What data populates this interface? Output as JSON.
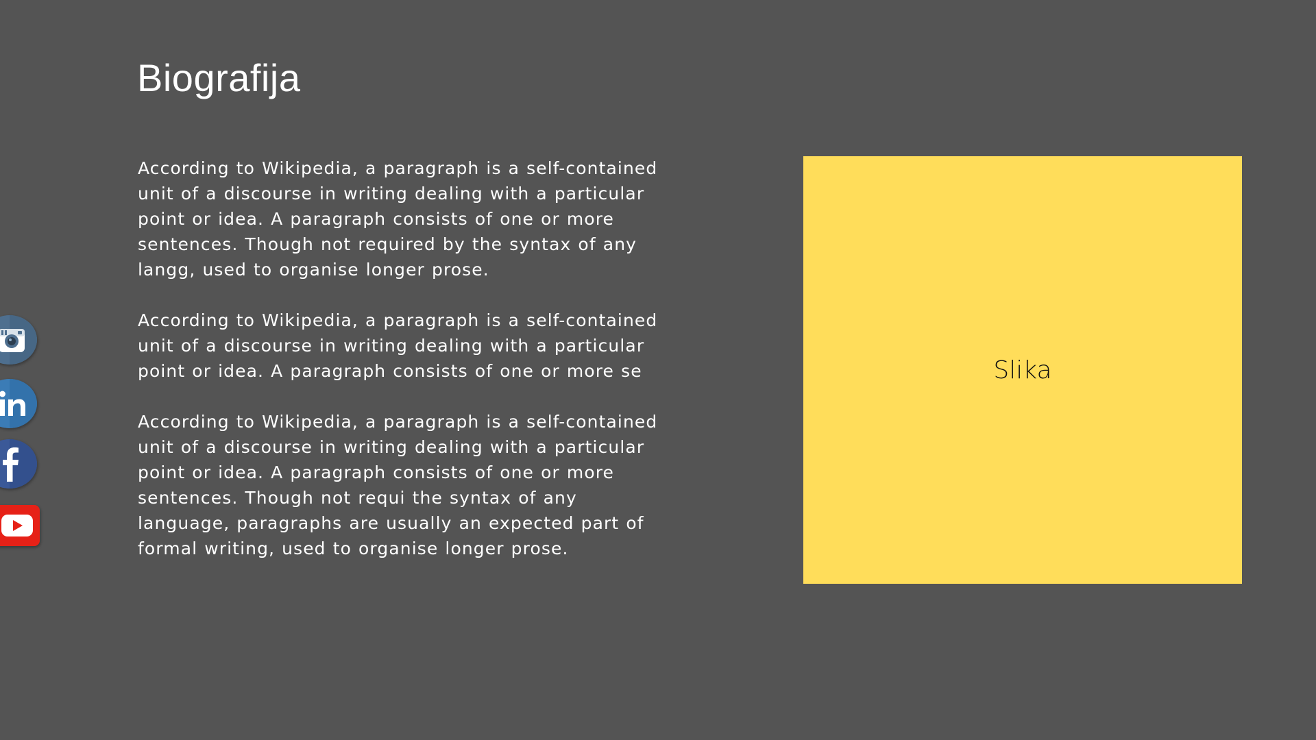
{
  "page": {
    "title": "Biografija",
    "background_color": "#545454",
    "text_color": "#ffffff"
  },
  "biography": {
    "paragraphs": [
      "According to Wikipedia, a paragraph is a self-contained unit of a discourse in writing dealing with a particular point or idea. A paragraph consists of one or more sentences. Though not required by the syntax of any langg, used to organise longer prose.",
      "According to Wikipedia, a paragraph is a self-contained unit of a discourse in writing dealing with a particular point or idea. A paragraph consists of one or more se",
      "According to Wikipedia, a paragraph is a self-contained unit of a discourse in writing dealing with a particular point or idea. A paragraph consists of one or more sentences. Though not requi the syntax of any language, paragraphs are usually an expected part of formal writing, used to organise longer prose."
    ]
  },
  "image_placeholder": {
    "label": "Slika",
    "fill_color": "#ffdd5a"
  },
  "social": [
    {
      "network": "instagram",
      "icon": "instagram-icon",
      "color": "#4e6f8f"
    },
    {
      "network": "linkedin",
      "icon": "linkedin-icon",
      "color": "#3b7cb6"
    },
    {
      "network": "facebook",
      "icon": "facebook-icon",
      "color": "#3b5998"
    },
    {
      "network": "youtube",
      "icon": "youtube-icon",
      "color": "#e62117"
    }
  ]
}
